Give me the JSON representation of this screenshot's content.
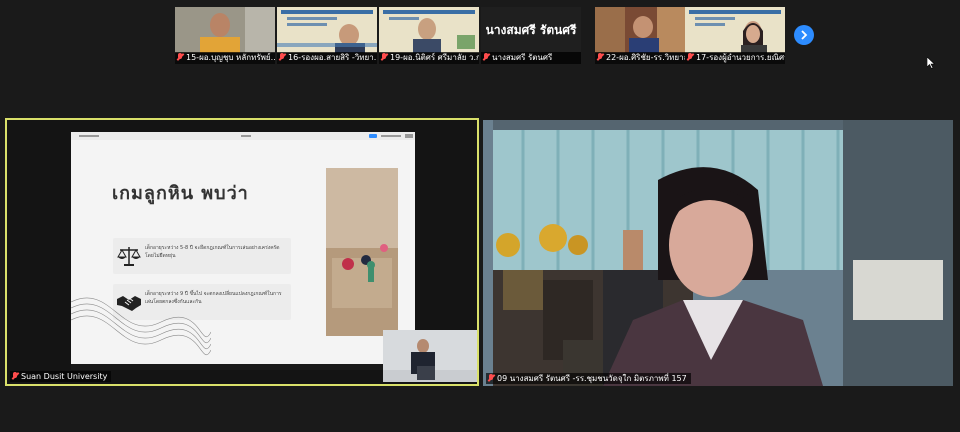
{
  "thumbnails": [
    {
      "label": "15-ผอ.บุญชุบ หลักทรัพย์...",
      "muted": true,
      "kind": "video"
    },
    {
      "label": "16-รองผอ.สายสิริ -วิทยา...",
      "muted": true,
      "kind": "video"
    },
    {
      "label": "19-ผอ.นิติศร์ ศรีมาลัย ว.ก...",
      "muted": true,
      "kind": "video"
    },
    {
      "label": "นางสมศรี รัตนศรี",
      "muted": true,
      "kind": "name",
      "display_name": "นางสมศรี รัตนศรี"
    },
    {
      "label": "22-ผอ.ศิริชัย-รร.วิทยาลัย...",
      "muted": true,
      "kind": "video"
    },
    {
      "label": "17-รองผู้อำนวยการ.ยณิศร์...",
      "muted": true,
      "kind": "video"
    }
  ],
  "next_page_icon": "chevron-right-icon",
  "main_left": {
    "label": "Suan Dusit University",
    "highlight_color": "#d9e06a",
    "slide": {
      "title": "เกมลูกหิน พบว่า",
      "items": [
        {
          "icon": "scales-icon",
          "text": "เด็กอายุระหว่าง 5-8 ปี จะยึดกฎเกณฑ์ในการเล่นอย่างเคร่งครัด โดยไม่ยืดหยุ่น"
        },
        {
          "icon": "handshake-icon",
          "text": "เด็กอายุระหว่าง 9 ปี ขึ้นไป จะตกลงเปลี่ยนแปลงกฎเกณฑ์ในการเล่นโดยตกลงซึ่งกันและกัน"
        }
      ]
    }
  },
  "main_right": {
    "label": "09 นางสมศรี รัตนศรี -รร.ชุมชนวัดจุใก มิตรภาพที่ 157"
  },
  "colors": {
    "accent": "#2d8cff",
    "muted_mic": "#ff4d4d",
    "active_border": "#d9e06a"
  }
}
